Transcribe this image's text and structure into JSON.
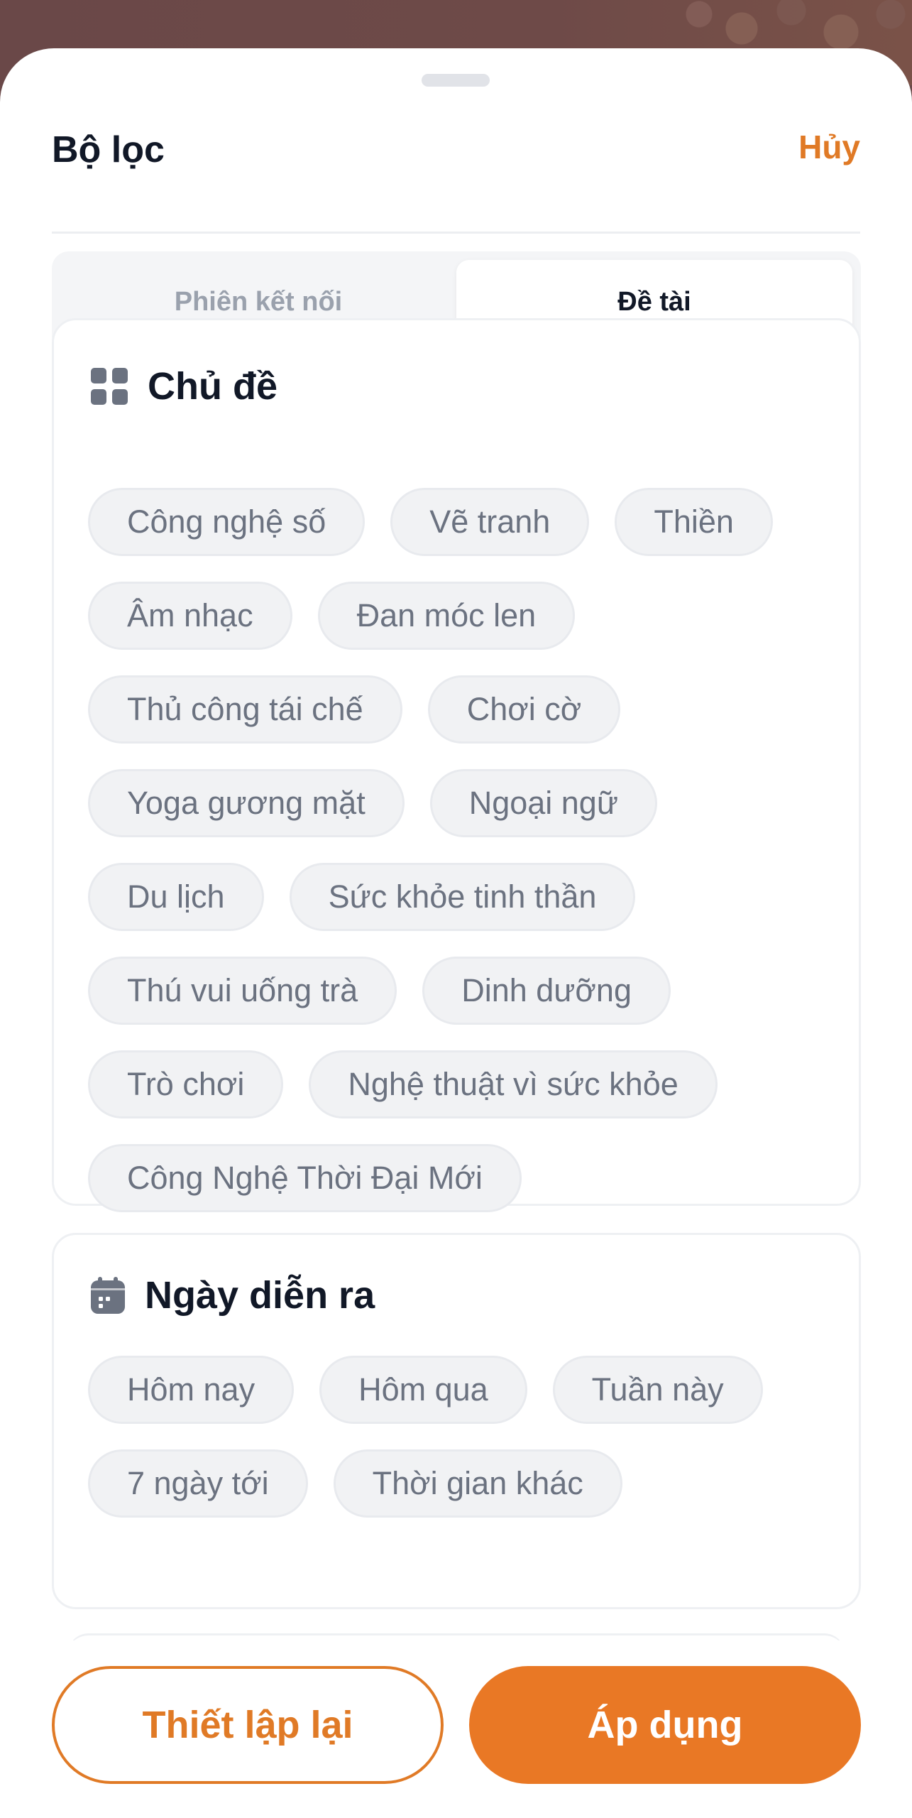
{
  "header": {
    "title": "Bộ lọc",
    "cancel_label": "Hủy"
  },
  "tabs": [
    {
      "label": "Phiên kết nối",
      "active": false
    },
    {
      "label": "Đề tài",
      "active": true
    }
  ],
  "topics": {
    "icon": "grid-icon",
    "title": "Chủ đề",
    "chips": [
      "Công nghệ số",
      "Vẽ tranh",
      "Thiền",
      "Âm nhạc",
      "Đan móc len",
      "Thủ công tái chế",
      "Chơi cờ",
      "Yoga gương mặt",
      "Ngoại ngữ",
      "Du lịch",
      "Sức khỏe tinh thần",
      "Thú vui uống trà",
      "Dinh dưỡng",
      "Trò chơi",
      "Nghệ thuật vì sức khỏe",
      "Công Nghệ Thời Đại Mới"
    ]
  },
  "dates": {
    "icon": "calendar-icon",
    "title": "Ngày diễn ra",
    "chips": [
      "Hôm nay",
      "Hôm qua",
      "Tuần này",
      "7 ngày tới",
      "Thời gian khác"
    ]
  },
  "footer": {
    "reset_label": "Thiết lập lại",
    "apply_label": "Áp dụng"
  },
  "colors": {
    "accent": "#e97825",
    "text_primary": "#111827",
    "chip_bg": "#f1f2f4",
    "chip_text": "#6b7280"
  }
}
